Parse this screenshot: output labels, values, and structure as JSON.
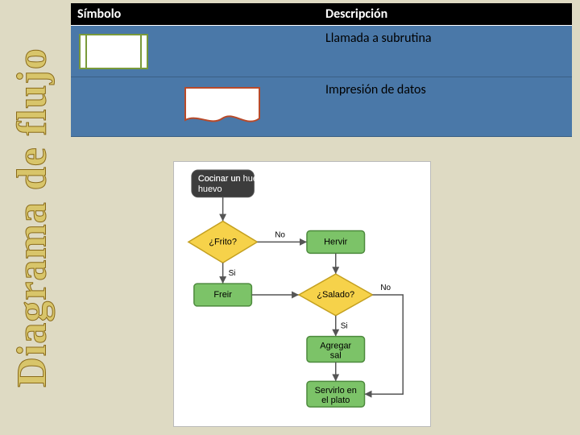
{
  "side_title": "Diagrama de flujo",
  "table": {
    "header_symbol": "Símbolo",
    "header_desc": "Descripción",
    "rows": [
      {
        "desc": "Llamada a subrutina"
      },
      {
        "desc": "Impresión de datos"
      }
    ]
  },
  "flowchart": {
    "start": "Cocinar un huevo",
    "decision1": "¿Frito?",
    "decision2": "¿Salado?",
    "proc_hervir": "Hervir",
    "proc_freir": "Freir",
    "proc_agregar": "Agregar sal",
    "proc_servir": "Servirlo en el plato",
    "label_si": "Si",
    "label_no": "No"
  }
}
